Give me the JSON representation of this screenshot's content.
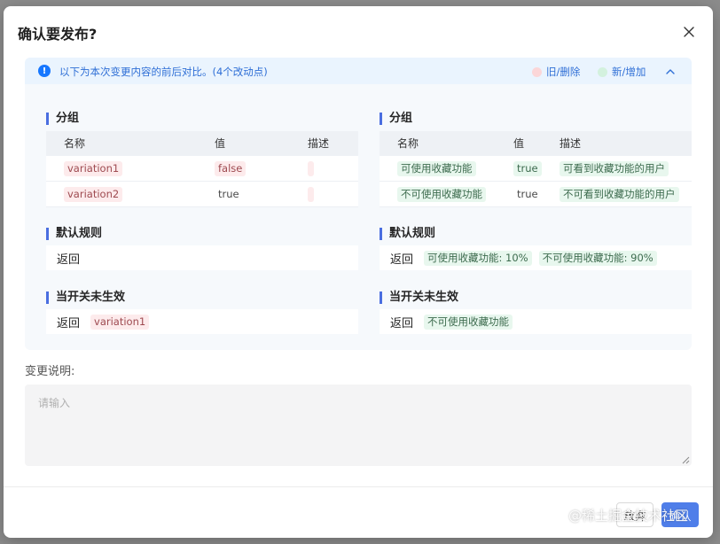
{
  "dialog": {
    "title": "确认要发布?",
    "info_text": "以下为本次变更内容的前后对比。(4个改动点)",
    "legend_old": "旧/删除",
    "legend_new": "新/增加",
    "legend_old_color": "#fbd6d8",
    "legend_new_color": "#d3f1de"
  },
  "left": {
    "group_title": "分组",
    "columns": [
      "名称",
      "值",
      "描述"
    ],
    "rows": [
      {
        "name": "variation1",
        "value": "false",
        "desc": ""
      },
      {
        "name": "variation2",
        "value": "true",
        "desc": ""
      }
    ],
    "default_rule_title": "默认规则",
    "default_rule_return": "返回",
    "off_title": "当开关未生效",
    "off_return": "返回",
    "off_value": "variation1"
  },
  "right": {
    "group_title": "分组",
    "columns": [
      "名称",
      "值",
      "描述"
    ],
    "rows": [
      {
        "name": "可使用收藏功能",
        "value": "true",
        "desc": "可看到收藏功能的用户"
      },
      {
        "name": "不可使用收藏功能",
        "value": "true",
        "desc": "不可看到收藏功能的用户"
      }
    ],
    "default_rule_title": "默认规则",
    "default_rule_return": "返回",
    "default_rule_tags": [
      "可使用收藏功能: 10%",
      "不可使用收藏功能: 90%"
    ],
    "off_title": "当开关未生效",
    "off_return": "返回",
    "off_value": "不可使用收藏功能"
  },
  "description": {
    "label": "变更说明:",
    "placeholder": "请输入"
  },
  "buttons": {
    "cancel": "放弃",
    "confirm": "确认"
  },
  "watermark": "@稀土掘金技术社区",
  "icons": {
    "close": "close-icon",
    "info": "info-circle-icon",
    "collapse": "chevron-up-icon"
  }
}
